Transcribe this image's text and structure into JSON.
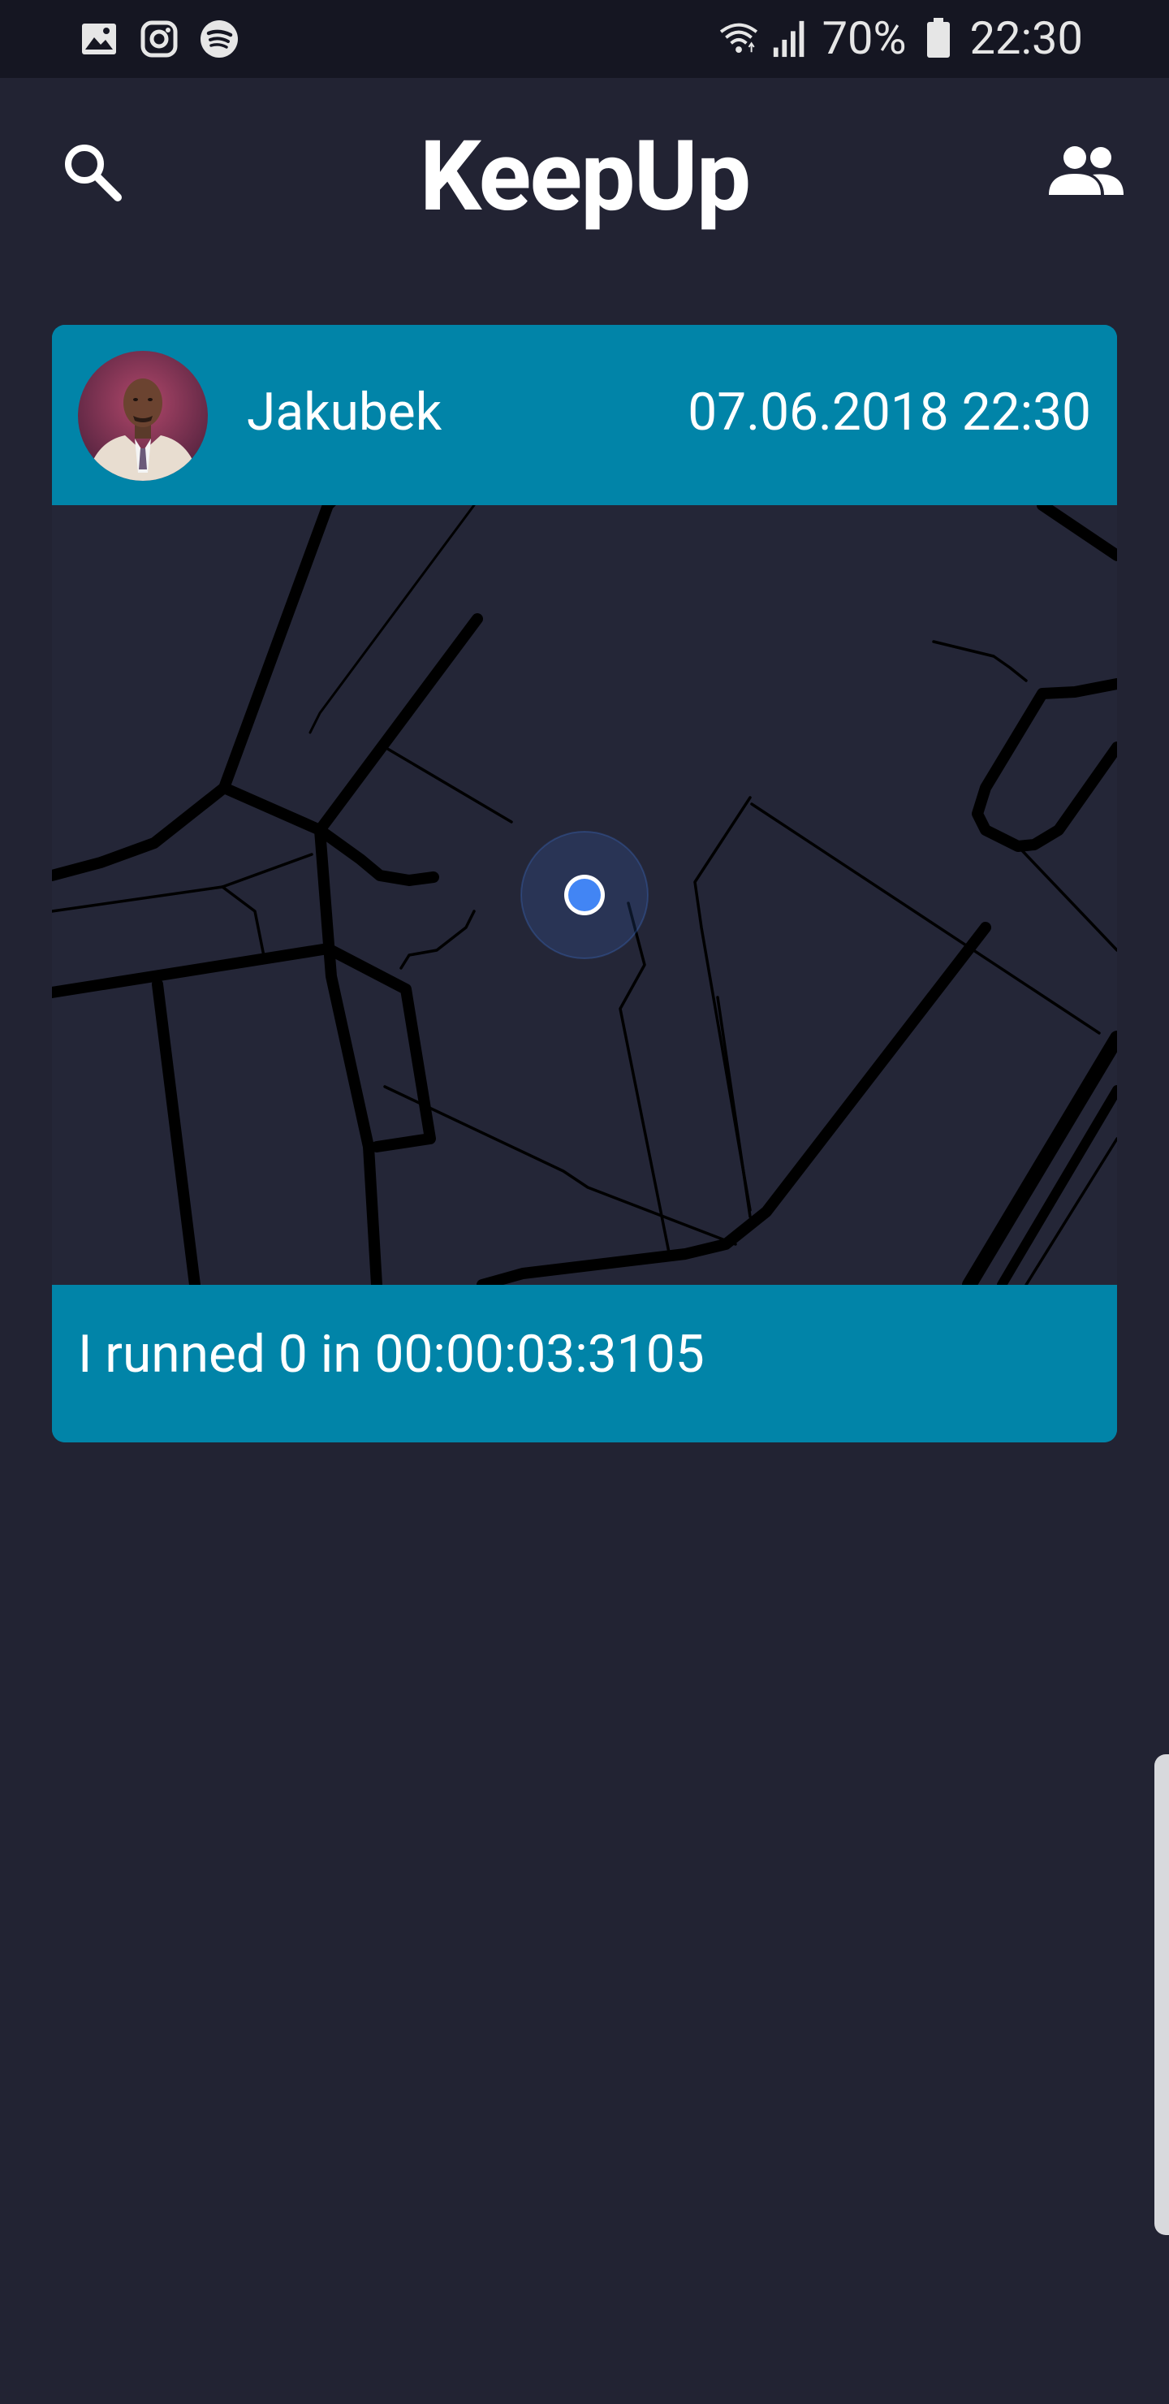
{
  "status_bar": {
    "battery_percent": "70%",
    "time": "22:30",
    "left_icons": [
      "gallery-icon",
      "instagram-icon",
      "spotify-icon"
    ],
    "right_icons": [
      "wifi-icon",
      "signal-icon",
      "battery-icon"
    ]
  },
  "app_bar": {
    "title": "KeepUp",
    "left_icon": "search-icon",
    "right_icon": "friends-icon"
  },
  "feed": {
    "items": [
      {
        "username": "Jakubek",
        "datetime": "07.06.2018 22:30",
        "summary": "I runned 0 in 00:00:03:3105"
      }
    ]
  },
  "colors": {
    "background": "#222333",
    "status_bar": "#151622",
    "card_accent": "#0184a8",
    "map_background": "#242637",
    "location_dot": "#4285f4"
  }
}
